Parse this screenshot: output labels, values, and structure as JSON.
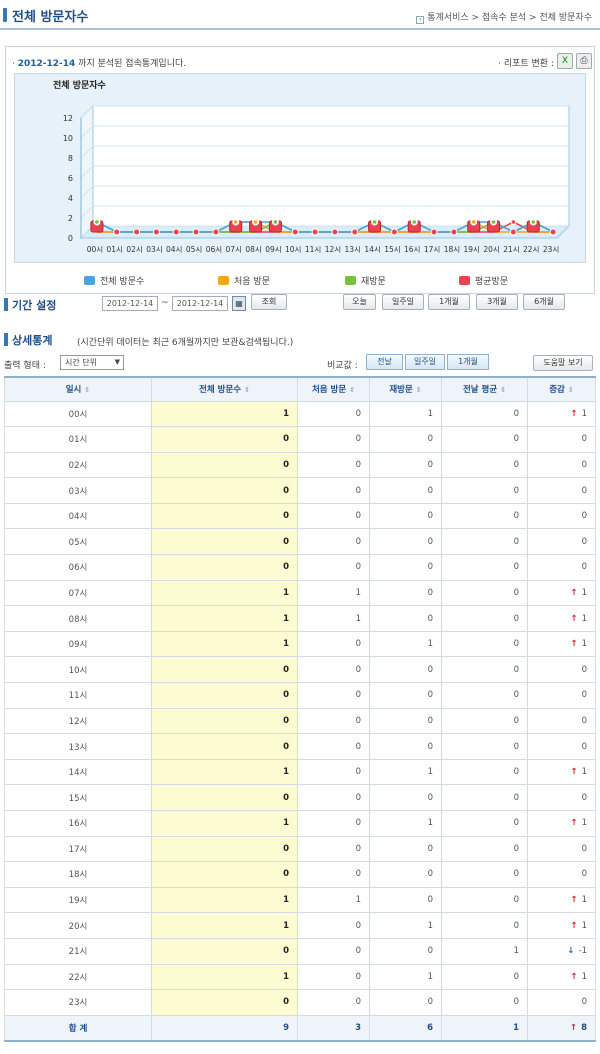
{
  "header": {
    "title": "전체 방문자수",
    "breadcrumb": "통계서비스 > 접속수 분석 > 전체 방문자수"
  },
  "report": {
    "date": "2012-12-14",
    "date_suffix": " 까지 분석된 접속통계입니다.",
    "report_convert_label": "· 리포트 변환 :",
    "excel_icon": "excel-icon",
    "print_icon": "printer-icon"
  },
  "chart_data": {
    "type": "line",
    "title": "전체 방문자수",
    "categories": [
      "00시",
      "01시",
      "02시",
      "03시",
      "04시",
      "05시",
      "06시",
      "07시",
      "08시",
      "09시",
      "10시",
      "11시",
      "12시",
      "13시",
      "14시",
      "15시",
      "16시",
      "17시",
      "18시",
      "19시",
      "20시",
      "21시",
      "22시",
      "23시"
    ],
    "ylim": [
      0,
      12
    ],
    "yticks": [
      0,
      2,
      4,
      6,
      8,
      10,
      12
    ],
    "series": [
      {
        "name": "전체 방문수",
        "color": "#4aa3df",
        "values": [
          1,
          0,
          0,
          0,
          0,
          0,
          0,
          1,
          1,
          1,
          0,
          0,
          0,
          0,
          1,
          0,
          1,
          0,
          0,
          1,
          1,
          0,
          1,
          0
        ]
      },
      {
        "name": "처음 방문",
        "color": "#f4a521",
        "values": [
          0,
          0,
          0,
          0,
          0,
          0,
          0,
          1,
          1,
          0,
          0,
          0,
          0,
          0,
          0,
          0,
          0,
          0,
          0,
          1,
          0,
          0,
          0,
          0
        ]
      },
      {
        "name": "재방문",
        "color": "#74c23f",
        "values": [
          1,
          0,
          0,
          0,
          0,
          0,
          0,
          0,
          0,
          1,
          0,
          0,
          0,
          0,
          1,
          0,
          1,
          0,
          0,
          0,
          1,
          0,
          1,
          0
        ]
      },
      {
        "name": "평균방문",
        "color": "#e8434f",
        "values": [
          0,
          0,
          0,
          0,
          0,
          0,
          0,
          0,
          0,
          0,
          0,
          0,
          0,
          0,
          0,
          0,
          0,
          0,
          0,
          0,
          0,
          1,
          0,
          0
        ]
      }
    ]
  },
  "period": {
    "label": "기간 설정",
    "start": "2012-12-14",
    "end": "2012-12-14",
    "tilde": "~",
    "search_label": "조회",
    "quick": [
      "오늘",
      "일주일",
      "1개월",
      "3개월",
      "6개월"
    ]
  },
  "detail": {
    "label": "상세통계",
    "note": "(시간단위 데이터는 최근 6개월까지만 보관&검색됩니다.)",
    "output_label": "출력 형태 :",
    "output_value": "시간 단위",
    "compare_label": "비교값 :",
    "compare_tabs": [
      "전날",
      "일주일",
      "1개월"
    ],
    "help_label": "도움말 보기"
  },
  "table": {
    "columns": [
      "일시",
      "전체 방문수",
      "처음 방문",
      "재방문",
      "전날 평균",
      "증감"
    ],
    "rows": [
      [
        "00시",
        "1",
        "0",
        "1",
        "0",
        "up",
        "1"
      ],
      [
        "01시",
        "0",
        "0",
        "0",
        "0",
        "",
        "0"
      ],
      [
        "02시",
        "0",
        "0",
        "0",
        "0",
        "",
        "0"
      ],
      [
        "03시",
        "0",
        "0",
        "0",
        "0",
        "",
        "0"
      ],
      [
        "04시",
        "0",
        "0",
        "0",
        "0",
        "",
        "0"
      ],
      [
        "05시",
        "0",
        "0",
        "0",
        "0",
        "",
        "0"
      ],
      [
        "06시",
        "0",
        "0",
        "0",
        "0",
        "",
        "0"
      ],
      [
        "07시",
        "1",
        "1",
        "0",
        "0",
        "up",
        "1"
      ],
      [
        "08시",
        "1",
        "1",
        "0",
        "0",
        "up",
        "1"
      ],
      [
        "09시",
        "1",
        "0",
        "1",
        "0",
        "up",
        "1"
      ],
      [
        "10시",
        "0",
        "0",
        "0",
        "0",
        "",
        "0"
      ],
      [
        "11시",
        "0",
        "0",
        "0",
        "0",
        "",
        "0"
      ],
      [
        "12시",
        "0",
        "0",
        "0",
        "0",
        "",
        "0"
      ],
      [
        "13시",
        "0",
        "0",
        "0",
        "0",
        "",
        "0"
      ],
      [
        "14시",
        "1",
        "0",
        "1",
        "0",
        "up",
        "1"
      ],
      [
        "15시",
        "0",
        "0",
        "0",
        "0",
        "",
        "0"
      ],
      [
        "16시",
        "1",
        "0",
        "1",
        "0",
        "up",
        "1"
      ],
      [
        "17시",
        "0",
        "0",
        "0",
        "0",
        "",
        "0"
      ],
      [
        "18시",
        "0",
        "0",
        "0",
        "0",
        "",
        "0"
      ],
      [
        "19시",
        "1",
        "1",
        "0",
        "0",
        "up",
        "1"
      ],
      [
        "20시",
        "1",
        "0",
        "1",
        "0",
        "up",
        "1"
      ],
      [
        "21시",
        "0",
        "0",
        "0",
        "1",
        "down",
        "-1"
      ],
      [
        "22시",
        "1",
        "0",
        "1",
        "0",
        "up",
        "1"
      ],
      [
        "23시",
        "0",
        "0",
        "0",
        "0",
        "",
        "0"
      ]
    ],
    "summary": [
      "합 계",
      "9",
      "3",
      "6",
      "1",
      "up",
      "8"
    ]
  }
}
